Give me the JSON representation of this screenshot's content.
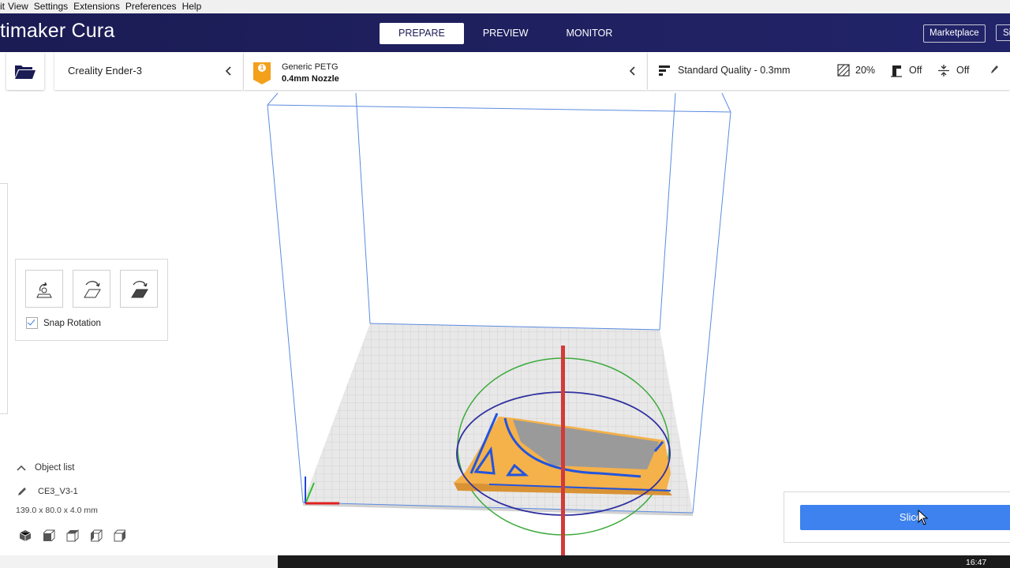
{
  "menu": [
    "it",
    "View",
    "Settings",
    "Extensions",
    "Preferences",
    "Help"
  ],
  "app": {
    "brand": "timaker Cura"
  },
  "stages": [
    "PREPARE",
    "PREVIEW",
    "MONITOR"
  ],
  "header": {
    "marketplace": "Marketplace",
    "signin": "Si"
  },
  "printer": {
    "name": "Creality Ender-3"
  },
  "material": {
    "badge": "1",
    "name": "Generic PETG",
    "nozzle": "0.4mm Nozzle"
  },
  "print_settings": {
    "quality": "Standard Quality - 0.3mm",
    "infill": "20%",
    "support": "Off",
    "adhesion": "Off"
  },
  "rotate_tool": {
    "snap_label": "Snap Rotation"
  },
  "objects": {
    "header": "Object list",
    "name": "CE3_V3-1",
    "dims": "139.0 x 80.0 x 4.0 mm"
  },
  "slice": {
    "label": "Slice"
  },
  "taskbar": {
    "time": "16:47"
  },
  "colors": {
    "header_bg": "#1b1c54",
    "accent": "#3d82ee",
    "model": "#f5b14a",
    "material_badge": "#f3a01b"
  }
}
